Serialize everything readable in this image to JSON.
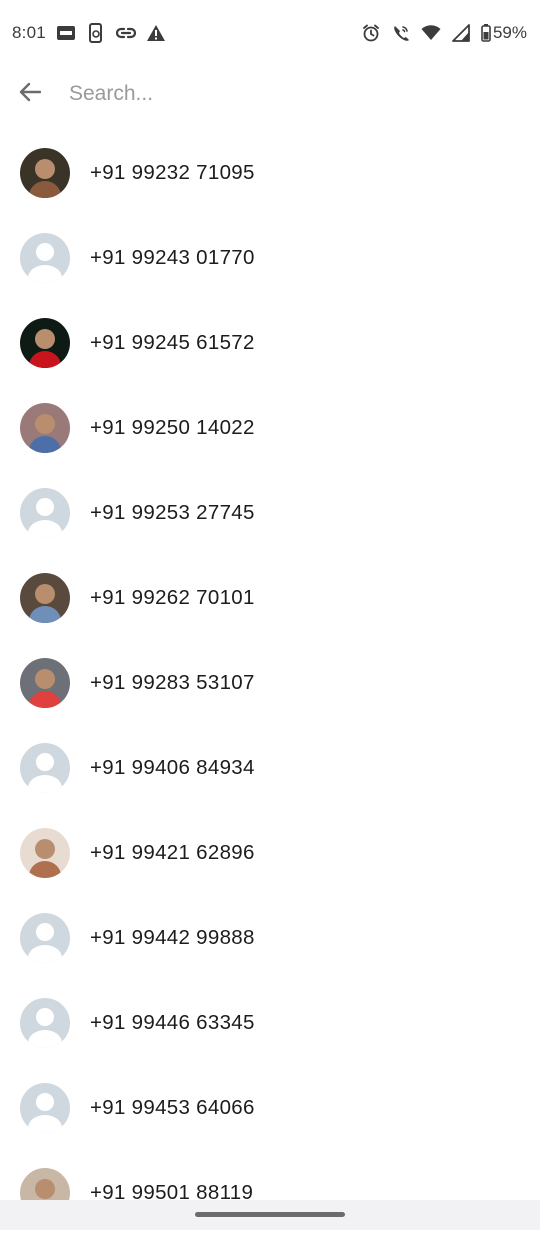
{
  "status_bar": {
    "time": "8:01",
    "battery_percent": "59%",
    "left_icons": [
      "news-icon",
      "phone-sync-icon",
      "link-icon",
      "warning-icon"
    ],
    "right_icons": [
      "alarm-icon",
      "wifi-calling-icon",
      "wifi-icon",
      "signal-icon",
      "battery-icon"
    ]
  },
  "search": {
    "placeholder": "Search...",
    "value": ""
  },
  "contacts": [
    {
      "phone": "+91 99232 71095",
      "avatar": "photo",
      "photo_colors": [
        "#3a3328",
        "#8a5a3c"
      ]
    },
    {
      "phone": "+91 99243 01770",
      "avatar": "default"
    },
    {
      "phone": "+91 99245 61572",
      "avatar": "photo",
      "photo_colors": [
        "#0e1a14",
        "#c8141c"
      ]
    },
    {
      "phone": "+91 99250 14022",
      "avatar": "photo",
      "photo_colors": [
        "#9a7a78",
        "#4d6fa8"
      ]
    },
    {
      "phone": "+91 99253 27745",
      "avatar": "default"
    },
    {
      "phone": "+91 99262 70101",
      "avatar": "photo",
      "photo_colors": [
        "#5a4a3e",
        "#6f8fb8"
      ]
    },
    {
      "phone": "+91 99283 53107",
      "avatar": "photo",
      "photo_colors": [
        "#6d7076",
        "#e0403e"
      ]
    },
    {
      "phone": "+91 99406 84934",
      "avatar": "default"
    },
    {
      "phone": "+91 99421 62896",
      "avatar": "photo",
      "photo_colors": [
        "#e8dcd2",
        "#b07050"
      ]
    },
    {
      "phone": "+91 99442 99888",
      "avatar": "default"
    },
    {
      "phone": "+91 99446 63345",
      "avatar": "default"
    },
    {
      "phone": "+91 99453 64066",
      "avatar": "default"
    },
    {
      "phone": "+91 99501 88119",
      "avatar": "photo",
      "photo_colors": [
        "#c9b7a6",
        "#8c6a52"
      ]
    }
  ],
  "colors": {
    "default_avatar_bg": "#cfd8df",
    "default_avatar_fg": "#ffffff",
    "text": "#1c1c1c",
    "placeholder": "#9a9a9a"
  }
}
